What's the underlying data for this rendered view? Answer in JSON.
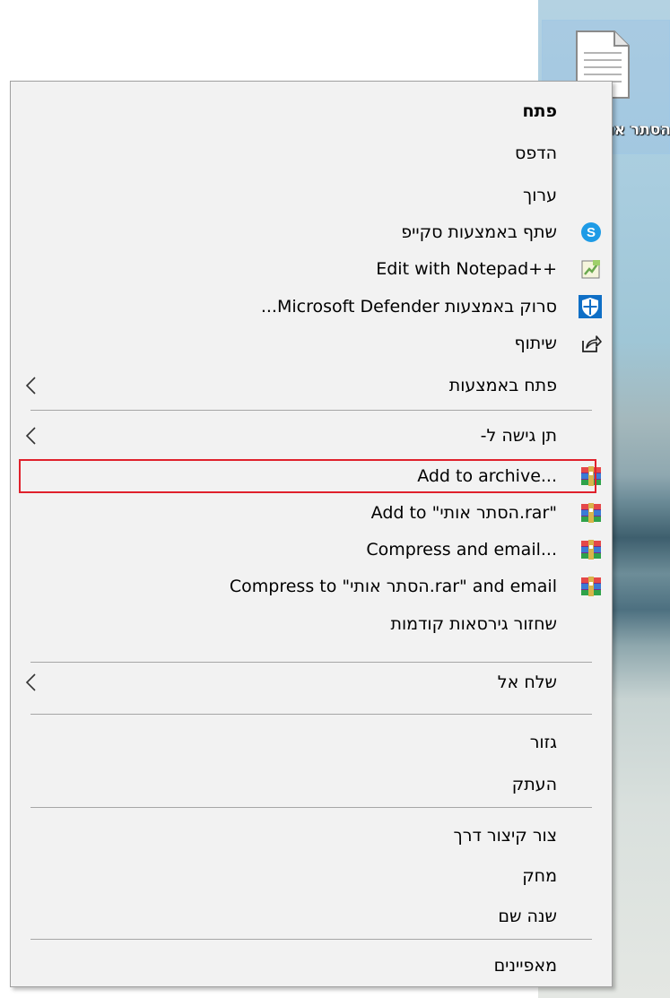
{
  "desktop": {
    "icon_label": "הסתר אותי.rar"
  },
  "menu": {
    "items": [
      {
        "label": "פתח",
        "bold": true
      },
      {
        "label": "הדפס"
      },
      {
        "label": "ערוך"
      },
      {
        "label": "שתף באמצעות סקייפ",
        "icon": "skype-icon"
      },
      {
        "label": "Edit with Notepad++",
        "icon": "notepad-plus-plus-icon"
      },
      {
        "label": "סרוק באמצעות Microsoft Defender...",
        "icon": "defender-shield-icon"
      },
      {
        "label": "שיתוף",
        "icon": "share-icon"
      },
      {
        "label": "פתח באמצעות",
        "submenu": true
      },
      {
        "label": "תן גישה ל-",
        "submenu": true
      },
      {
        "label": "Add to archive...",
        "icon": "winrar-icon",
        "highlighted": true
      },
      {
        "label": "Add to \"הסתר אותי.rar\"",
        "icon": "winrar-icon"
      },
      {
        "label": "Compress and email...",
        "icon": "winrar-icon"
      },
      {
        "label": "Compress to \"הסתר אותי.rar\" and email",
        "icon": "winrar-icon"
      },
      {
        "label": "שחזור גירסאות קודמות"
      },
      {
        "label": "שלח אל",
        "submenu": true
      },
      {
        "label": "גזור"
      },
      {
        "label": "העתק"
      },
      {
        "label": "צור קיצור דרך"
      },
      {
        "label": "מחק"
      },
      {
        "label": "שנה שם"
      },
      {
        "label": "מאפיינים"
      }
    ]
  },
  "colors": {
    "menu_bg": "#f2f2f2",
    "separator": "#a6a6a6",
    "highlight_border": "#e0212c"
  }
}
